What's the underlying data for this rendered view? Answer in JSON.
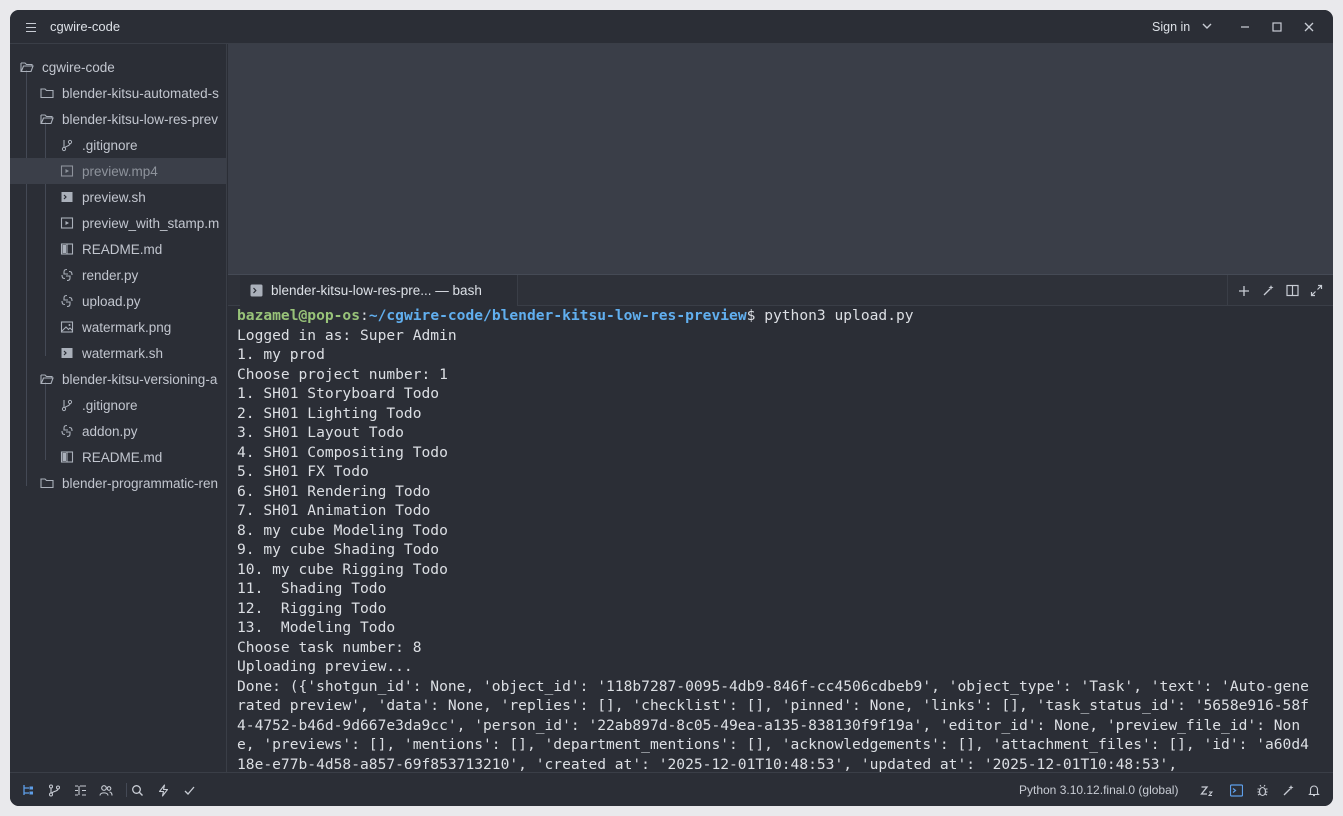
{
  "title_bar": {
    "project_name": "cgwire-code",
    "sign_in_label": "Sign in"
  },
  "sidebar": {
    "root": "cgwire-code",
    "items": [
      {
        "label": "blender-kitsu-automated-s",
        "kind": "folder-closed",
        "depth": 1
      },
      {
        "label": "blender-kitsu-low-res-prev",
        "kind": "folder-open",
        "depth": 1
      },
      {
        "label": ".gitignore",
        "kind": "git",
        "depth": 2
      },
      {
        "label": "preview.mp4",
        "kind": "video",
        "depth": 2,
        "selected": true
      },
      {
        "label": "preview.sh",
        "kind": "terminal",
        "depth": 2
      },
      {
        "label": "preview_with_stamp.m",
        "kind": "video",
        "depth": 2
      },
      {
        "label": "README.md",
        "kind": "book",
        "depth": 2
      },
      {
        "label": "render.py",
        "kind": "python",
        "depth": 2
      },
      {
        "label": "upload.py",
        "kind": "python",
        "depth": 2
      },
      {
        "label": "watermark.png",
        "kind": "image",
        "depth": 2
      },
      {
        "label": "watermark.sh",
        "kind": "terminal",
        "depth": 2
      },
      {
        "label": "blender-kitsu-versioning-a",
        "kind": "folder-open",
        "depth": 1
      },
      {
        "label": ".gitignore",
        "kind": "git",
        "depth": 2
      },
      {
        "label": "addon.py",
        "kind": "python",
        "depth": 2
      },
      {
        "label": "README.md",
        "kind": "book",
        "depth": 2
      },
      {
        "label": "blender-programmatic-ren",
        "kind": "folder-closed",
        "depth": 1
      }
    ]
  },
  "terminal_panel": {
    "tab_label": "blender-kitsu-low-res-pre... — bash"
  },
  "terminal": {
    "prompt_user": "bazamel@pop-os",
    "prompt_colon": ":",
    "prompt_path": "~/cgwire-code/blender-kitsu-low-res-preview",
    "prompt_command": "$ python3 upload.py",
    "lines": [
      "Logged in as: Super Admin",
      "1. my prod",
      "Choose project number: 1",
      "1. SH01 Storyboard Todo",
      "2. SH01 Lighting Todo",
      "3. SH01 Layout Todo",
      "4. SH01 Compositing Todo",
      "5. SH01 FX Todo",
      "6. SH01 Rendering Todo",
      "7. SH01 Animation Todo",
      "8. my cube Modeling Todo",
      "9. my cube Shading Todo",
      "10. my cube Rigging Todo",
      "11.  Shading Todo",
      "12.  Rigging Todo",
      "13.  Modeling Todo",
      "Choose task number: 8",
      "Uploading preview..."
    ],
    "done_output": "Done: ({'shotgun_id': None, 'object_id': '118b7287-0095-4db9-846f-cc4506cdbeb9', 'object_type': 'Task', 'text': 'Auto-generated preview', 'data': None, 'replies': [], 'checklist': [], 'pinned': None, 'links': [], 'task_status_id': '5658e916-58f4-4752-b46d-9d667e3da9cc', 'person_id': '22ab897d-8c05-49ea-a135-838130f9f19a', 'editor_id': None, 'preview_file_id': None, 'previews': [], 'mentions': [], 'department_mentions': [], 'acknowledgements': [], 'attachment_files': [], 'id': 'a60d418e-e77b-4d58-a857-69f853713210', 'created_at': '2025-12-01T10:48:53', 'updated_at': '2025-12-01T10:48:53',"
  },
  "status_bar": {
    "python_version": "Python 3.10.12.final.0 (global)"
  },
  "colors": {
    "background": "#2b2e36",
    "editor_empty": "#3a3e48",
    "prompt_user": "#98c379",
    "prompt_path": "#61afef",
    "accent": "#5e9ee8"
  }
}
